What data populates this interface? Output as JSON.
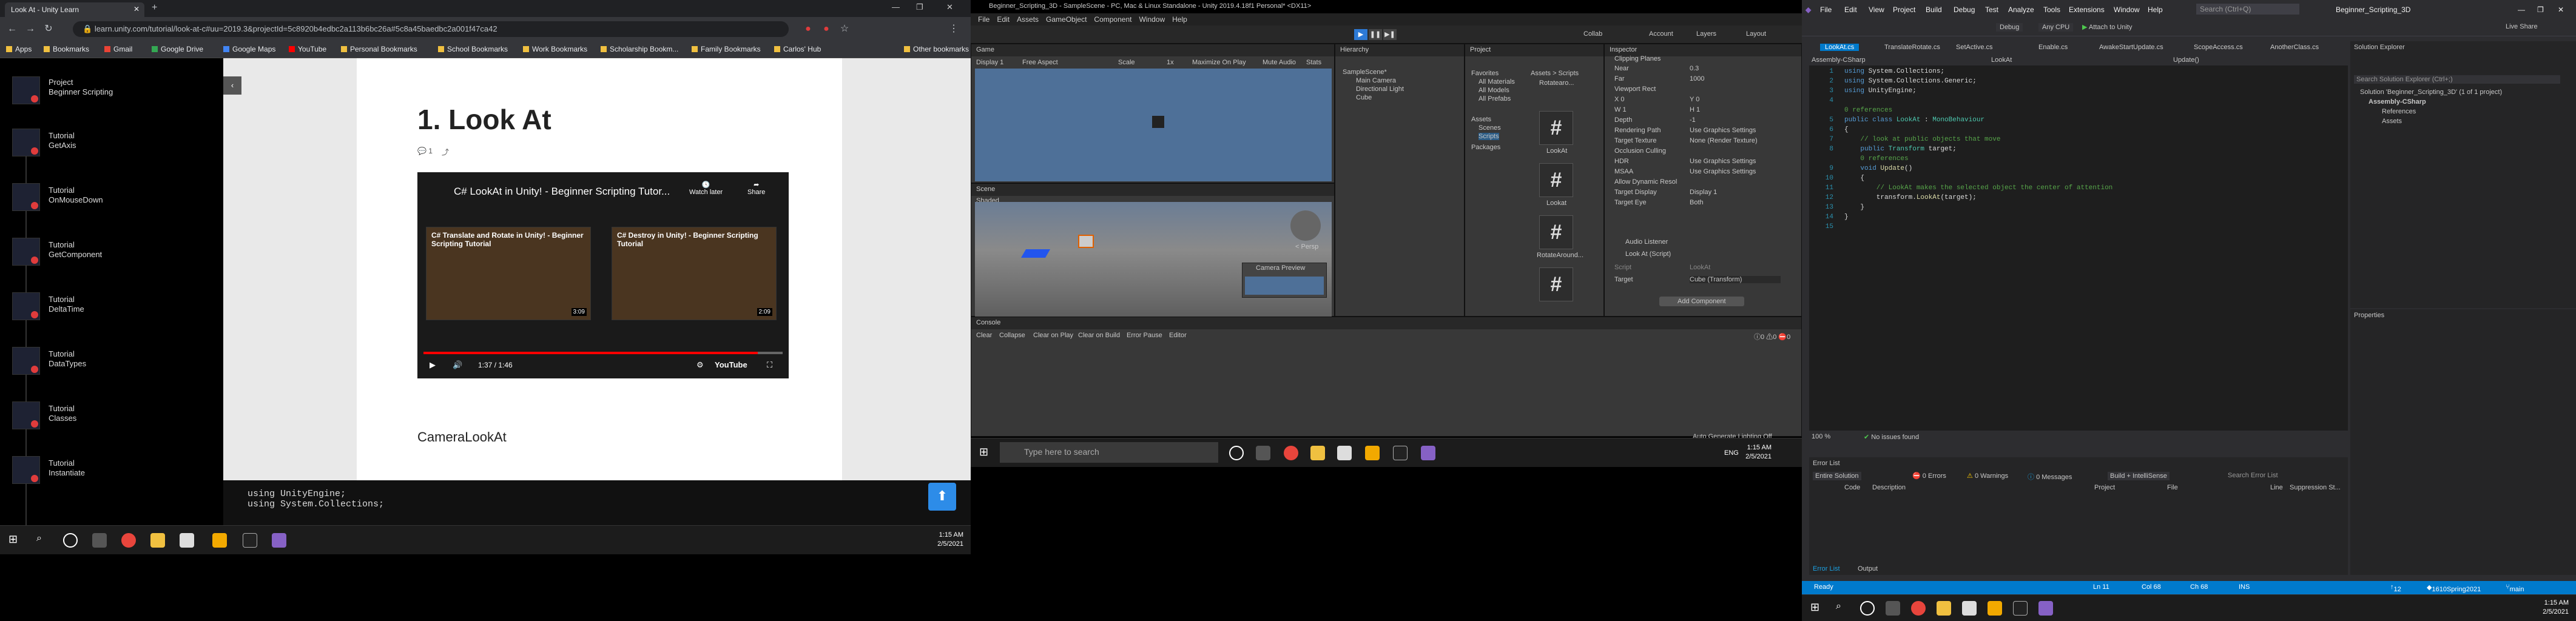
{
  "chrome": {
    "tab_title": "Look At - Unity Learn",
    "url": "learn.unity.com/tutorial/look-at-c#uu=2019.3&projectId=5c8920b4edbc2a113b6bc26a#5c8a45baedbc2a001f47ca42",
    "bookmarks": [
      "Apps",
      "Bookmarks",
      "Gmail",
      "Google Drive",
      "Google Maps",
      "YouTube",
      "Personal Bookmarks",
      "School Bookmarks",
      "Work Bookmarks",
      "Scholarship Bookm...",
      "Family Bookmarks",
      "Carlos' Hub"
    ],
    "other_bookmarks": "Other bookmarks"
  },
  "learn": {
    "project_label": "Project",
    "project_name": "Beginner Scripting",
    "tutorials": [
      {
        "t": "Tutorial",
        "n": "GetAxis"
      },
      {
        "t": "Tutorial",
        "n": "OnMouseDown"
      },
      {
        "t": "Tutorial",
        "n": "GetComponent"
      },
      {
        "t": "Tutorial",
        "n": "DeltaTime"
      },
      {
        "t": "Tutorial",
        "n": "DataTypes"
      },
      {
        "t": "Tutorial",
        "n": "Classes"
      },
      {
        "t": "Tutorial",
        "n": "Instantiate"
      }
    ],
    "title": "1. Look At",
    "comments": "1",
    "video_title": "C# LookAt in Unity! - Beginner Scripting Tutor...",
    "watch_later": "Watch later",
    "share": "Share",
    "card1": "C# Translate and Rotate in Unity! - Beginner Scripting Tutorial",
    "card2": "C# Destroy in Unity! - Beginner Scripting Tutorial",
    "card_time1": "3:09",
    "card_time2": "2:09",
    "time": "1:37 / 1:46",
    "progress": 0.93,
    "youtube": "YouTube",
    "subheading": "CameraLookAt",
    "code1": "using UnityEngine;",
    "code2": "using System.Collections;"
  },
  "taskbar": {
    "time": "1:15 AM",
    "date": "2/5/2021",
    "search": "Type here to search",
    "lang": "ENG"
  },
  "unity": {
    "title": "Beginner_Scripting_3D - SampleScene - PC, Mac & Linux Standalone - Unity 2019.4.18f1 Personal* <DX11>",
    "menu": [
      "File",
      "Edit",
      "Assets",
      "GameObject",
      "Component",
      "Window",
      "Help"
    ],
    "account": "Account",
    "layers": "Layers",
    "layout": "Layout",
    "collab": "Collab",
    "game_tab": "Game",
    "display": "Display 1",
    "aspect": "Free Aspect",
    "scale": "Scale",
    "scale_val": "1x",
    "game_opts": [
      "Maximize On Play",
      "Mute Audio",
      "Stats"
    ],
    "scene_tab": "Scene",
    "shaded": "Shaded",
    "persp": "< Persp",
    "camera_preview": "Camera Preview",
    "hierarchy": "Hierarchy",
    "h_items": [
      "SampleScene*",
      "Main Camera",
      "Directional Light",
      "Cube"
    ],
    "project": "Project",
    "favorites": "Favorites",
    "fav_items": [
      "All Materials",
      "All Models",
      "All Prefabs"
    ],
    "assets": "Assets",
    "asset_items": [
      "Scenes",
      "Scripts"
    ],
    "packages": "Packages",
    "breadcrumb": "Assets > Scripts",
    "scripts": [
      "LookAt",
      "Lookat",
      "RotateAround..."
    ],
    "script0": "Rotatearo...",
    "inspector": "Inspector",
    "insp_rows": [
      [
        "Near",
        "0.3"
      ],
      [
        "Far",
        "1000"
      ],
      [
        "Viewport Rect",
        ""
      ],
      [
        "X 0",
        "Y 0"
      ],
      [
        "W 1",
        "H 1"
      ],
      [
        "Depth",
        "-1"
      ],
      [
        "Rendering Path",
        "Use Graphics Settings"
      ],
      [
        "Target Texture",
        "None (Render Texture)"
      ],
      [
        "Occlusion Culling",
        ""
      ],
      [
        "HDR",
        "Use Graphics Settings"
      ],
      [
        "MSAA",
        "Use Graphics Settings"
      ],
      [
        "Allow Dynamic Resol",
        ""
      ],
      [
        "Target Display",
        "Display 1"
      ],
      [
        "Target Eye",
        "Both"
      ]
    ],
    "audio_listener": "Audio Listener",
    "lookat_comp": "Look At (Script)",
    "script_lbl": "Script",
    "script_val": "LookAt",
    "target_lbl": "Target",
    "target_val": "Cube (Transform)",
    "add_component": "Add Component",
    "clipping": "Clipping Planes",
    "console": "Console",
    "console_btns": [
      "Clear",
      "Collapse",
      "Clear on Play",
      "Clear on Build",
      "Error Pause",
      "Editor"
    ],
    "console_counts": [
      "0",
      "0",
      "0"
    ],
    "auto_gen": "Auto Generate Lighting Off"
  },
  "vs": {
    "menu": [
      "File",
      "Edit",
      "View",
      "Project",
      "Build",
      "Debug",
      "Test",
      "Analyze",
      "Tools",
      "Extensions",
      "Window",
      "Help"
    ],
    "search": "Search (Ctrl+Q)",
    "title": "Beginner_Scripting_3D",
    "live_share": "Live Share",
    "config": "Debug",
    "platform": "Any CPU",
    "attach": "Attach to Unity",
    "tabs": [
      "LookAt.cs",
      "TranslateRotate.cs",
      "SetActive.cs",
      "Enable.cs",
      "AwakeStartUpdate.cs",
      "ScopeAccess.cs",
      "AnotherClass.cs"
    ],
    "dd1": "Assembly-CSharp",
    "dd2": "LookAt",
    "dd3": "Update()",
    "code": [
      {
        "n": "1",
        "parts": [
          [
            "kw",
            "using "
          ],
          [
            "",
            "System.Collections;"
          ]
        ]
      },
      {
        "n": "2",
        "parts": [
          [
            "kw",
            "using "
          ],
          [
            "",
            "System.Collections.Generic;"
          ]
        ]
      },
      {
        "n": "3",
        "parts": [
          [
            "kw",
            "using "
          ],
          [
            "",
            "UnityEngine;"
          ]
        ]
      },
      {
        "n": "4",
        "parts": []
      },
      {
        "n": "",
        "parts": [
          [
            "cm",
            "0 references"
          ]
        ]
      },
      {
        "n": "5",
        "parts": [
          [
            "kw",
            "public class "
          ],
          [
            "ty",
            "LookAt"
          ],
          [
            "",
            " : "
          ],
          [
            "ty",
            "MonoBehaviour"
          ]
        ]
      },
      {
        "n": "6",
        "parts": [
          [
            "",
            "{"
          ]
        ]
      },
      {
        "n": "7",
        "parts": [
          [
            "cm",
            "    // look at public objects that move"
          ]
        ]
      },
      {
        "n": "8",
        "parts": [
          [
            "kw",
            "    public "
          ],
          [
            "ty",
            "Transform"
          ],
          [
            "",
            " target;"
          ]
        ]
      },
      {
        "n": "",
        "parts": [
          [
            "cm",
            "    0 references"
          ]
        ]
      },
      {
        "n": "9",
        "parts": [
          [
            "kw",
            "    void "
          ],
          [
            "mt",
            "Update"
          ],
          [
            "",
            "()"
          ]
        ]
      },
      {
        "n": "10",
        "parts": [
          [
            "",
            "    {"
          ]
        ]
      },
      {
        "n": "11",
        "parts": [
          [
            "cm",
            "        // LookAt makes the selected object the center of attention"
          ]
        ]
      },
      {
        "n": "12",
        "parts": [
          [
            "",
            "        transform."
          ],
          [
            "mt",
            "LookAt"
          ],
          [
            "",
            "(target);"
          ]
        ]
      },
      {
        "n": "13",
        "parts": [
          [
            "",
            "    }"
          ]
        ]
      },
      {
        "n": "14",
        "parts": [
          [
            "",
            "}"
          ]
        ]
      },
      {
        "n": "15",
        "parts": []
      }
    ],
    "zoom": "100 %",
    "no_issues": "No issues found",
    "se_title": "Solution Explorer",
    "se_search": "Search Solution Explorer (Ctrl+;)",
    "se_items": [
      "Solution 'Beginner_Scripting_3D' (1 of 1 project)",
      "Assembly-CSharp",
      "References",
      "Assets"
    ],
    "props": "Properties",
    "err_title": "Error List",
    "err_scope": "Entire Solution",
    "errors": "0 Errors",
    "warnings": "0 Warnings",
    "messages": "0 Messages",
    "build": "Build + IntelliSense",
    "err_search": "Search Error List",
    "err_cols": [
      "Code",
      "Description",
      "Project",
      "File",
      "Line",
      "Suppression St..."
    ],
    "bottom_tabs": [
      "Error List",
      "Output"
    ],
    "status": {
      "ready": "Ready",
      "ln": "Ln 11",
      "col": "Col 68",
      "ch": "Ch 68",
      "ins": "INS",
      "up": "12",
      "branch": "1610Spring2021",
      "main": "main"
    }
  }
}
